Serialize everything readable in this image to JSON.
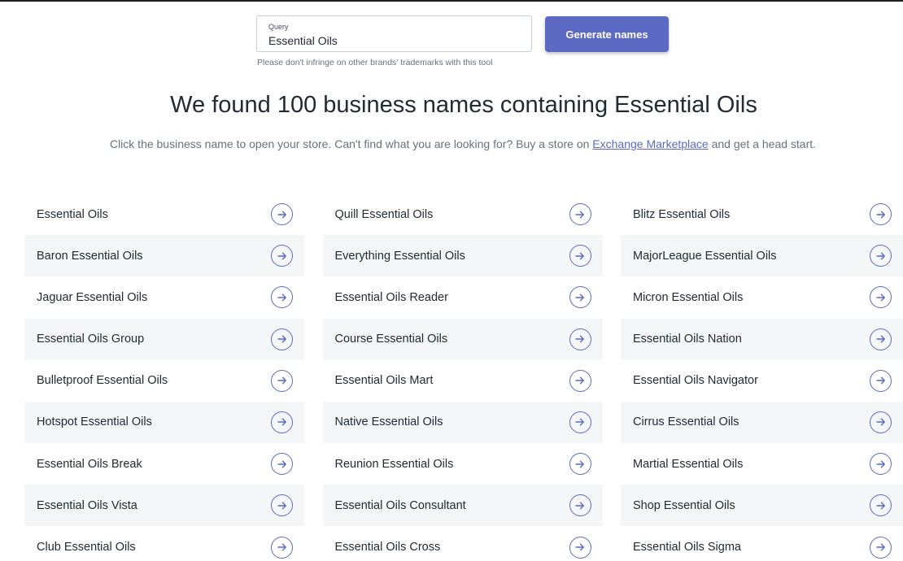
{
  "search": {
    "label": "Query",
    "value": "Essential Oils",
    "button_label": "Generate names",
    "disclaimer": "Please don't infringe on other brands' trademarks with this tool"
  },
  "results": {
    "heading": "We found 100 business names containing Essential Oils",
    "subtext_before": "Click the business name to open your store. Can't find what you are looking for? Buy a store on ",
    "subtext_link": "Exchange Marketplace",
    "subtext_after": " and get a head start.",
    "names": [
      [
        "Essential Oils",
        "Quill Essential Oils",
        "Blitz Essential Oils"
      ],
      [
        "Baron Essential Oils",
        "Everything Essential Oils",
        "MajorLeague Essential Oils"
      ],
      [
        "Jaguar Essential Oils",
        "Essential Oils Reader",
        "Micron Essential Oils"
      ],
      [
        "Essential Oils Group",
        "Course Essential Oils",
        "Essential Oils Nation"
      ],
      [
        "Bulletproof Essential Oils",
        "Essential Oils Mart",
        "Essential Oils Navigator"
      ],
      [
        "Hotspot Essential Oils",
        "Native Essential Oils",
        "Cirrus Essential Oils"
      ],
      [
        "Essential Oils Break",
        "Reunion Essential Oils",
        "Martial Essential Oils"
      ],
      [
        "Essential Oils Vista",
        "Essential Oils Consultant",
        "Shop Essential Oils"
      ],
      [
        "Club Essential Oils",
        "Essential Oils Cross",
        "Essential Oils Sigma"
      ]
    ]
  },
  "colors": {
    "accent": "#5c6ac4",
    "row_alt": "#f4f6f8",
    "text": "#212b36",
    "muted": "#637381"
  },
  "icons": {
    "row_action": "arrow-right-circle-icon"
  }
}
